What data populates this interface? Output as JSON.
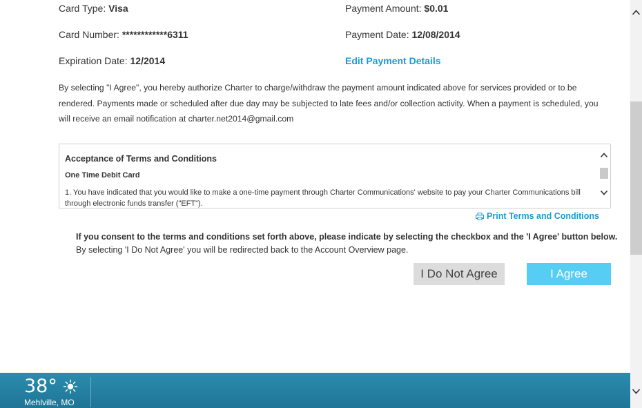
{
  "payment": {
    "card_type_label": "Card Type:",
    "card_type_value": "Visa",
    "card_number_label": "Card Number:",
    "card_number_value": "************6311",
    "expiration_label": "Expiration Date:",
    "expiration_value": "12/2014",
    "amount_label": "Payment Amount:",
    "amount_value": "$0.01",
    "date_label": "Payment Date:",
    "date_value": "12/08/2014",
    "edit_link": "Edit Payment Details"
  },
  "disclaimer": "By selecting \"I Agree\", you hereby authorize Charter to charge/withdraw the payment amount indicated above for services provided or to be rendered. Payments made or scheduled after due day may be subjected to late fees and/or collection activity. When a payment is scheduled, you will receive an email notification at charter.net2014@gmail.com",
  "terms": {
    "title": "Acceptance of Terms and Conditions",
    "subtitle": "One Time Debit Card",
    "text": "1. You have indicated that you would like to make a one-time payment through Charter Communications' website to pay your Charter Communications bill through electronic funds transfer (\"EFT\")."
  },
  "print_link": "Print Terms and Conditions",
  "consent": {
    "line1": "If you consent to the terms and conditions set forth above, please indicate by selecting the checkbox and the 'I Agree' button below.",
    "line2": "By selecting 'I Do Not Agree' you will be redirected back to the Account Overview page."
  },
  "buttons": {
    "disagree": "I Do Not Agree",
    "agree": "I Agree"
  },
  "colors": {
    "link": "#1a9ad6",
    "agree_button": "#56cdf2",
    "disagree_button": "#dcdcdc",
    "taskbar": "#2383a6"
  },
  "taskbar": {
    "temperature": "38°",
    "weather_icon": "sun-icon",
    "location": "Mehlville, MO"
  }
}
